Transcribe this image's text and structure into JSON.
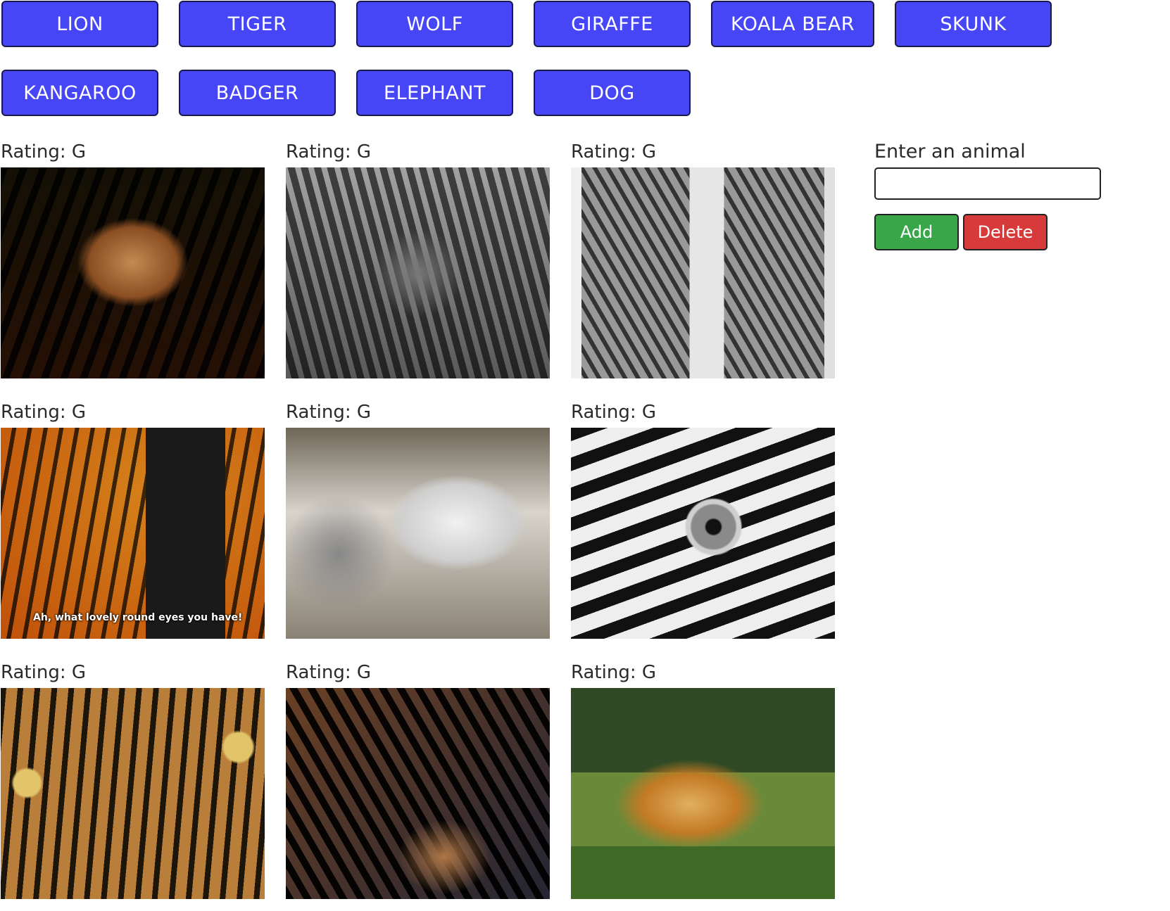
{
  "animal_buttons": {
    "row1": [
      "LION",
      "TIGER",
      "WOLF",
      "GIRAFFE",
      "KOALA BEAR",
      "SKUNK"
    ],
    "row2": [
      "KANGAROO",
      "BADGER",
      "ELEPHANT",
      "DOG"
    ]
  },
  "gifs": [
    {
      "rating": "Rating: G"
    },
    {
      "rating": "Rating: G"
    },
    {
      "rating": "Rating: G"
    },
    {
      "rating": "Rating: G",
      "caption": "Ah, what lovely round eyes you have!"
    },
    {
      "rating": "Rating: G"
    },
    {
      "rating": "Rating: G"
    },
    {
      "rating": "Rating: G"
    },
    {
      "rating": "Rating: G"
    },
    {
      "rating": "Rating: G"
    }
  ],
  "form": {
    "label": "Enter an animal",
    "input_value": "",
    "add_label": "Add",
    "delete_label": "Delete"
  },
  "colors": {
    "animal_button": "#4646f7",
    "add_button": "#3aa64a",
    "delete_button": "#d63a3a"
  }
}
